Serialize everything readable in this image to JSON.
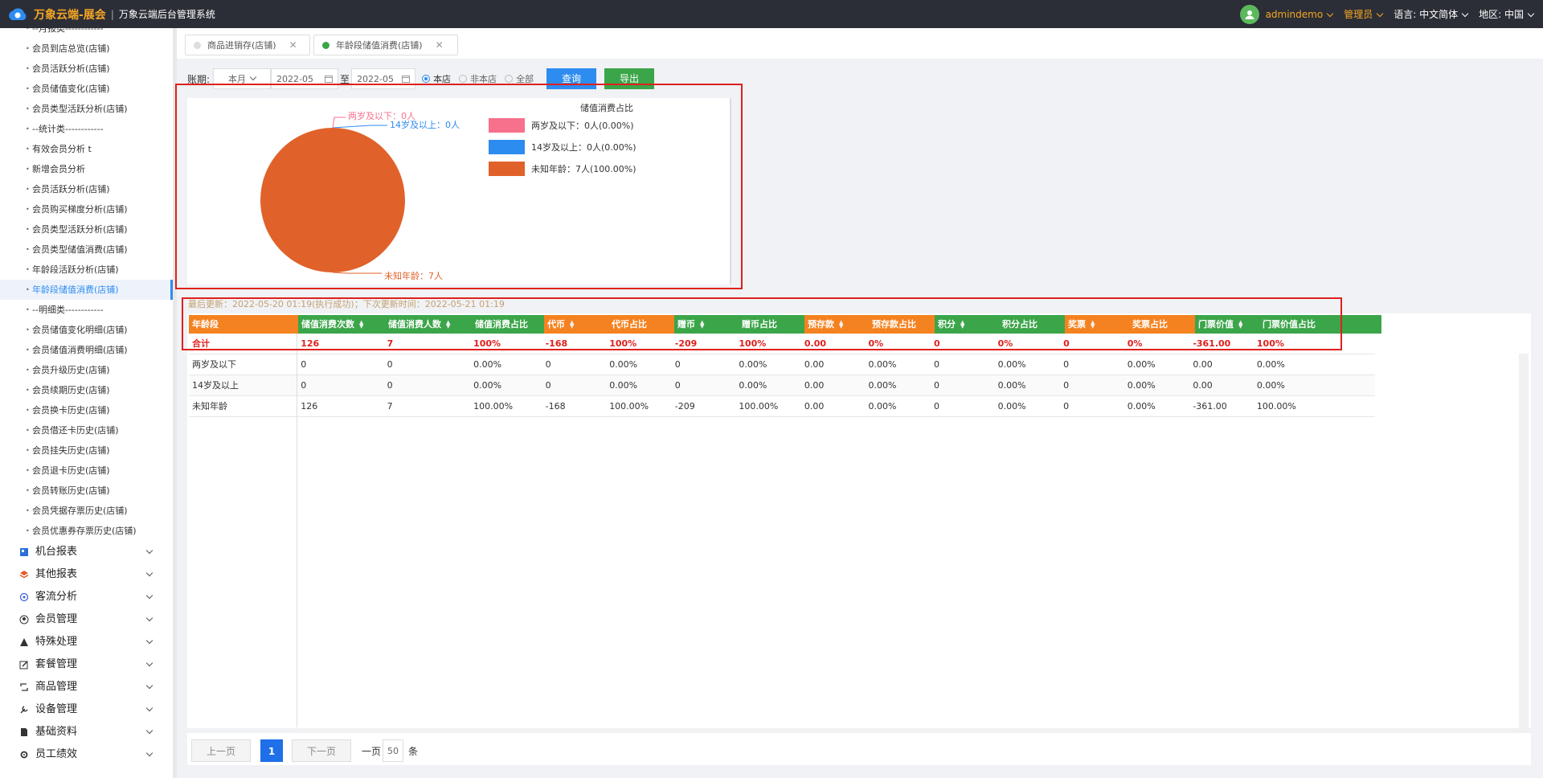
{
  "header": {
    "brand": "万象云端-展会",
    "subtitle": "万象云端后台管理系统",
    "username": "admindemo",
    "role": "管理员",
    "language_label": "语言:",
    "language_value": "中文简体",
    "region_label": "地区:",
    "region_value": "中国"
  },
  "sidebar": {
    "items": [
      {
        "label": "--月报类------------"
      },
      {
        "label": "会员到店总览(店铺)"
      },
      {
        "label": "会员活跃分析(店铺)"
      },
      {
        "label": "会员储值变化(店铺)"
      },
      {
        "label": "会员类型活跃分析(店铺)"
      },
      {
        "label": "--统计类------------"
      },
      {
        "label": "有效会员分析 t"
      },
      {
        "label": "新增会员分析"
      },
      {
        "label": "会员活跃分析(店铺)"
      },
      {
        "label": "会员购买梯度分析(店铺)"
      },
      {
        "label": "会员类型活跃分析(店铺)"
      },
      {
        "label": "会员类型储值消费(店铺)"
      },
      {
        "label": "年龄段活跃分析(店铺)"
      },
      {
        "label": "年龄段储值消费(店铺)",
        "active": true
      },
      {
        "label": "--明细类------------"
      },
      {
        "label": "会员储值变化明细(店铺)"
      },
      {
        "label": "会员储值消费明细(店铺)"
      },
      {
        "label": "会员升级历史(店铺)"
      },
      {
        "label": "会员续期历史(店铺)"
      },
      {
        "label": "会员换卡历史(店铺)"
      },
      {
        "label": "会员借还卡历史(店铺)"
      },
      {
        "label": "会员挂失历史(店铺)"
      },
      {
        "label": "会员退卡历史(店铺)"
      },
      {
        "label": "会员转账历史(店铺)"
      },
      {
        "label": "会员凭据存票历史(店铺)"
      },
      {
        "label": "会员优惠券存票历史(店铺)"
      }
    ],
    "groups": [
      {
        "label": "机台报表",
        "icon": "report-icon",
        "color": "#2d6fd6"
      },
      {
        "label": "其他报表",
        "icon": "layers-icon",
        "color": "#e05a2b"
      },
      {
        "label": "客流分析",
        "icon": "target-icon",
        "color": "#3b5bdb"
      },
      {
        "label": "会员管理",
        "icon": "user-icon",
        "color": "#333333"
      },
      {
        "label": "特殊处理",
        "icon": "warning-icon",
        "color": "#333333"
      },
      {
        "label": "套餐管理",
        "icon": "edit-icon",
        "color": "#333333"
      },
      {
        "label": "商品管理",
        "icon": "refresh-icon",
        "color": "#333333"
      },
      {
        "label": "设备管理",
        "icon": "tools-icon",
        "color": "#333333"
      },
      {
        "label": "基础资料",
        "icon": "file-icon",
        "color": "#333333"
      },
      {
        "label": "员工绩效",
        "icon": "gear-icon",
        "color": "#333333"
      }
    ]
  },
  "tabs": [
    {
      "label": "商品进销存(店铺)",
      "active": false
    },
    {
      "label": "年龄段储值消费(店铺)",
      "active": true
    }
  ],
  "filter": {
    "period_label": "账期:",
    "period_select": "本月",
    "date_from": "2022-05",
    "to_label": "至",
    "date_to": "2022-05",
    "radio_this_store": "本店",
    "radio_other_store": "非本店",
    "radio_all": "全部",
    "query_button": "查询",
    "export_button": "导出"
  },
  "chart_data": {
    "type": "pie",
    "title": "储值消费占比",
    "slices": [
      {
        "name": "两岁及以下",
        "value": 0,
        "label": "两岁及以下：0人",
        "legend": "两岁及以下：0人(0.00%)",
        "color": "#f7718c"
      },
      {
        "name": "14岁及以上",
        "value": 0,
        "label": "14岁及以上：0人",
        "legend": "14岁及以上：0人(0.00%)",
        "color": "#2d8cf0"
      },
      {
        "name": "未知年龄",
        "value": 7,
        "label": "未知年龄：7人",
        "legend": "未知年龄：7人(100.00%)",
        "color": "#e0622a"
      }
    ],
    "legend_position": "right"
  },
  "status": {
    "text": "最后更新：2022-05-20 01:19(执行成功)；下次更新时间：2022-05-21 01:19"
  },
  "table": {
    "columns": [
      {
        "label": "年龄段",
        "sortable": false,
        "color": "#f58220"
      },
      {
        "label": "储值消费次数",
        "sortable": true,
        "color": "#3ba549"
      },
      {
        "label": "储值消费人数",
        "sortable": true,
        "color": "#3ba549"
      },
      {
        "label": "储值消费占比",
        "sortable": false,
        "color": "#3ba549"
      },
      {
        "label": "代币",
        "sortable": true,
        "color": "#f58220"
      },
      {
        "label": "代币占比",
        "sortable": false,
        "color": "#f58220"
      },
      {
        "label": "赠币",
        "sortable": true,
        "color": "#3ba549"
      },
      {
        "label": "赠币占比",
        "sortable": false,
        "color": "#3ba549"
      },
      {
        "label": "预存款",
        "sortable": true,
        "color": "#f58220"
      },
      {
        "label": "预存款占比",
        "sortable": false,
        "color": "#f58220"
      },
      {
        "label": "积分",
        "sortable": true,
        "color": "#3ba549"
      },
      {
        "label": "积分占比",
        "sortable": false,
        "color": "#3ba549"
      },
      {
        "label": "奖票",
        "sortable": true,
        "color": "#f58220"
      },
      {
        "label": "奖票占比",
        "sortable": false,
        "color": "#f58220"
      },
      {
        "label": "门票价值",
        "sortable": true,
        "color": "#3ba549"
      },
      {
        "label": "门票价值占比",
        "sortable": false,
        "color": "#3ba549"
      }
    ],
    "total": [
      "合计",
      "126",
      "7",
      "100%",
      "-168",
      "100%",
      "-209",
      "100%",
      "0.00",
      "0%",
      "0",
      "0%",
      "0",
      "0%",
      "-361.00",
      "100%"
    ],
    "rows": [
      [
        "两岁及以下",
        "0",
        "0",
        "0.00%",
        "0",
        "0.00%",
        "0",
        "0.00%",
        "0.00",
        "0.00%",
        "0",
        "0.00%",
        "0",
        "0.00%",
        "0.00",
        "0.00%"
      ],
      [
        "14岁及以上",
        "0",
        "0",
        "0.00%",
        "0",
        "0.00%",
        "0",
        "0.00%",
        "0.00",
        "0.00%",
        "0",
        "0.00%",
        "0",
        "0.00%",
        "0.00",
        "0.00%"
      ],
      [
        "未知年龄",
        "126",
        "7",
        "100.00%",
        "-168",
        "100.00%",
        "-209",
        "100.00%",
        "0.00",
        "0.00%",
        "0",
        "0.00%",
        "0",
        "0.00%",
        "-361.00",
        "100.00%"
      ]
    ]
  },
  "pager": {
    "prev": "上一页",
    "current": "1",
    "next": "下一页",
    "per_page_label": "一页",
    "per_page_value": "50",
    "unit": "条"
  },
  "colors": {
    "accent_blue": "#2d8cf0",
    "query_button": "#2d8cf0",
    "export_button": "#3ba549",
    "highlight_red": "#e0201d"
  }
}
